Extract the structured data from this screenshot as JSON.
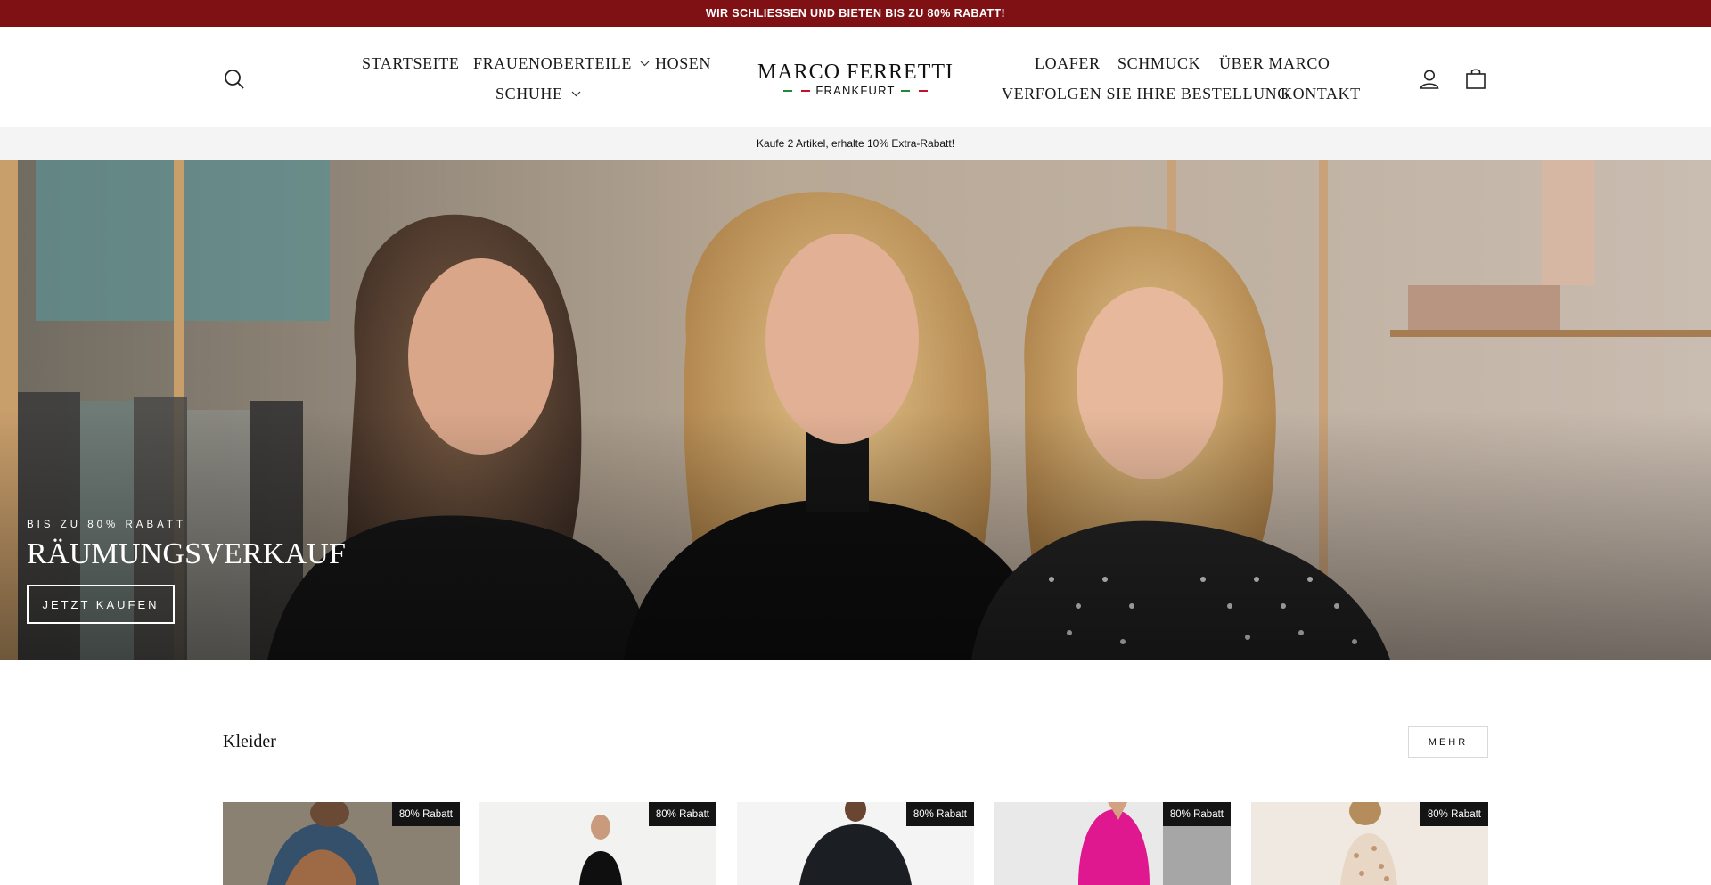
{
  "announcement": "WIR SCHLIESSEN UND BIETEN BIS ZU 80% RABATT!",
  "header": {
    "nav_left": [
      "STARTSEITE",
      "FRAUENOBERTEILE",
      "HOSEN",
      "SCHUHE"
    ],
    "nav_right": [
      "LOAFER",
      "SCHMUCK",
      "ÜBER MARCO",
      "VERFOLGEN SIE IHRE BESTELLUNG",
      "KONTAKT"
    ],
    "logo": {
      "name": "MARCO FERRETTI",
      "city": "FRANKFURT"
    },
    "icons": [
      "search-icon",
      "account-icon",
      "cart-icon",
      "chevron-down-icon"
    ]
  },
  "promo_bar": "Kaufe 2 Artikel, erhalte 10% Extra-Rabatt!",
  "hero": {
    "eyebrow": "BIS ZU 80% RABATT",
    "title": "RÄUMUNGSVERKAUF",
    "button": "JETZT KAUFEN"
  },
  "collection": {
    "title": "Kleider",
    "more_button": "MEHR",
    "products": [
      {
        "badge": "80% Rabatt"
      },
      {
        "badge": "80% Rabatt"
      },
      {
        "badge": "80% Rabatt"
      },
      {
        "badge": "80% Rabatt"
      },
      {
        "badge": "80% Rabatt"
      }
    ]
  },
  "colors": {
    "announcement_bg": "#7f1114",
    "badge_bg": "#141414",
    "promo_bg": "#f4f4f4",
    "flag_green": "#1f8a3b",
    "flag_red": "#c8102e"
  }
}
